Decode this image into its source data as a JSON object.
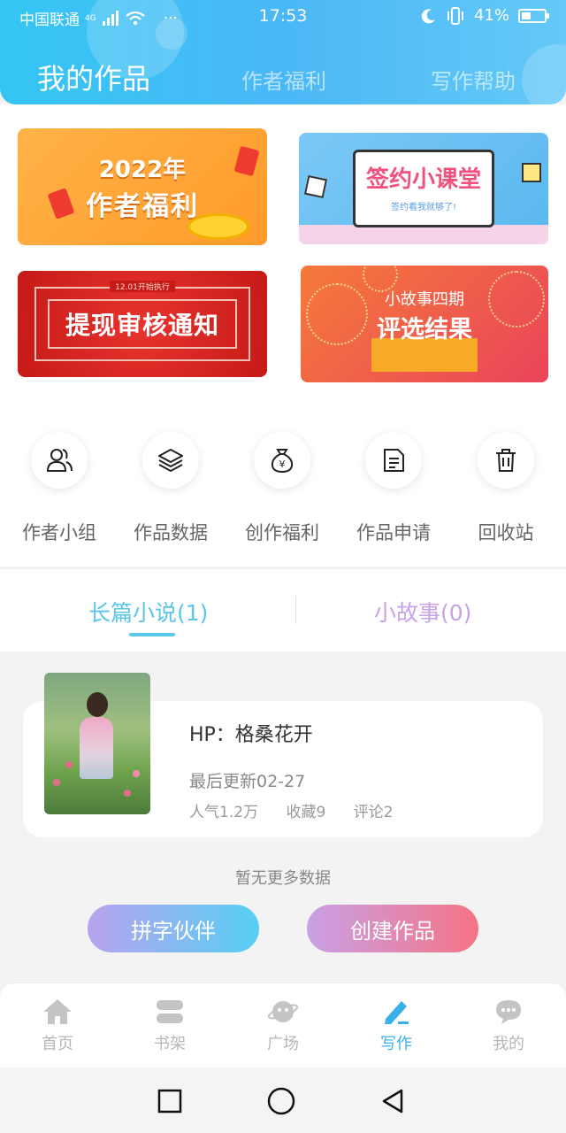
{
  "status_bar": {
    "carrier": "中国联通",
    "network": "4G",
    "time": "17:53",
    "battery": "41%",
    "battery_level": 0.41
  },
  "header_tabs": [
    "我的作品",
    "作者福利",
    "写作帮助"
  ],
  "banners": {
    "welfare": {
      "year": "2022年",
      "title": "作者福利"
    },
    "class": {
      "title": "签约小课堂",
      "subtitle": "签约看我就够了!"
    },
    "withdraw": {
      "tag": "12.01开始执行",
      "title": "提现审核通知"
    },
    "contest": {
      "line1": "小故事四期",
      "line2": "评选结果"
    }
  },
  "quick_actions": [
    {
      "label": "作者小组",
      "icon": "group-icon"
    },
    {
      "label": "作品数据",
      "icon": "layers-icon"
    },
    {
      "label": "创作福利",
      "icon": "money-bag-icon"
    },
    {
      "label": "作品申请",
      "icon": "document-icon"
    },
    {
      "label": "回收站",
      "icon": "trash-icon"
    }
  ],
  "work_tabs": {
    "novel": "长篇小说(1)",
    "story": "小故事(0)"
  },
  "work": {
    "title": "HP：格桑花开",
    "updated": "最后更新02-27",
    "popularity": "人气1.2万",
    "favorites": "收藏9",
    "comments": "评论2"
  },
  "no_more": "暂无更多数据",
  "buttons": {
    "partner": "拼字伙伴",
    "create": "创建作品"
  },
  "bottom_nav": [
    {
      "label": "首页",
      "icon": "home-icon"
    },
    {
      "label": "书架",
      "icon": "bookshelf-icon"
    },
    {
      "label": "广场",
      "icon": "planet-icon"
    },
    {
      "label": "写作",
      "icon": "pen-icon"
    },
    {
      "label": "我的",
      "icon": "chat-icon"
    }
  ],
  "colors": {
    "accent": "#3ab0ea",
    "header": "#4ab8f6",
    "story_tab": "#c8a2e6"
  }
}
